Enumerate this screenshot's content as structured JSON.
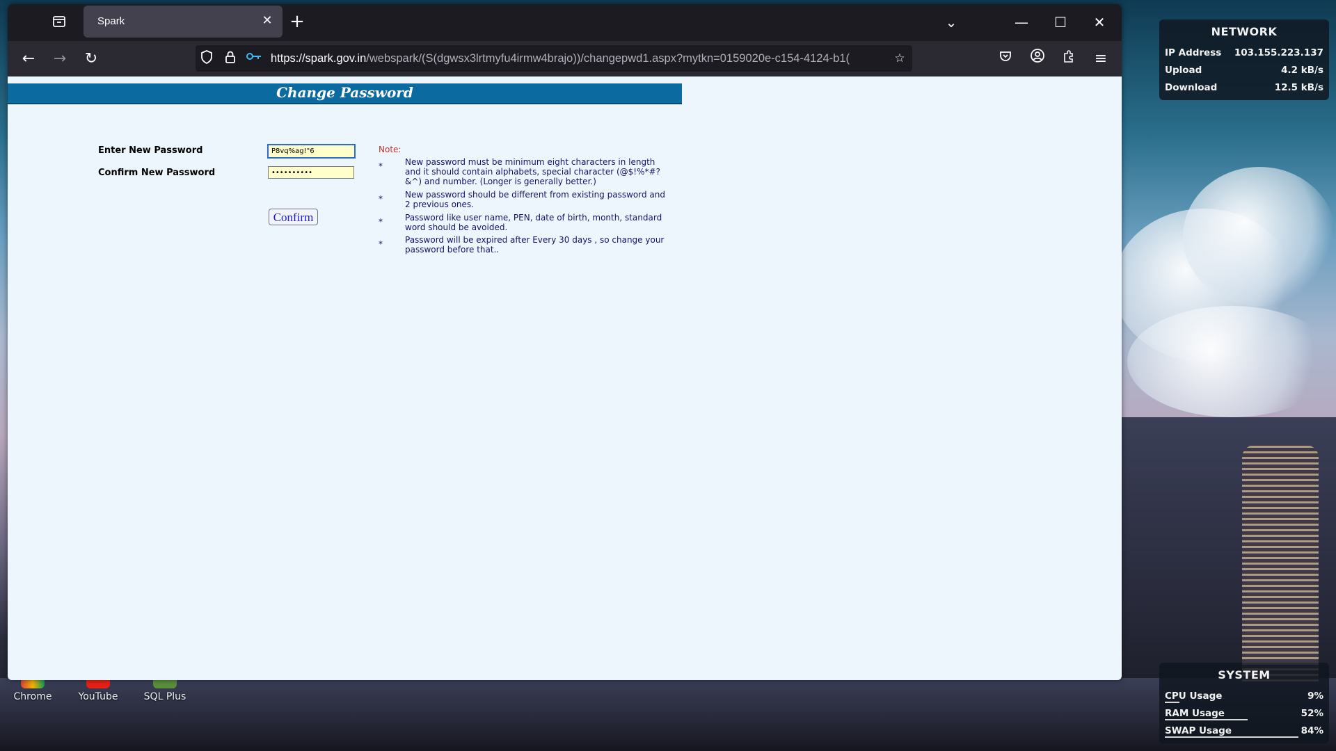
{
  "browser": {
    "tab_title": "Spark",
    "url_host": "https://spark.gov.in",
    "url_path": "/webspark/(S(dgwsx3lrtmyfu4irmw4brajo))/changepwd1.aspx?mytkn=0159020e-c154-4124-b1("
  },
  "page": {
    "title": "Change Password",
    "new_password_label": "Enter New Password",
    "new_password_value": "P8vq%ag!\"6",
    "confirm_password_label": "Confirm New Password",
    "confirm_password_value": "••••••••••",
    "confirm_button": "Confirm",
    "note_label": "Note:",
    "notes": [
      "New password  must be minimum eight characters in length and it should contain alphabets, special character (@$!%*#?&^) and number. (Longer is generally better.)",
      "New password should be different from existing password and 2 previous ones.",
      "Password like user name, PEN, date of birth, month, standard word should be avoided.",
      "Password will be expired after Every 30 days , so change your password before that.."
    ],
    "bullet": "*"
  },
  "desktop": {
    "icons": [
      {
        "label": "Chrome"
      },
      {
        "label": "YouTube"
      },
      {
        "label": "SQL Plus"
      }
    ]
  },
  "network_widget": {
    "title": "NETWORK",
    "rows": [
      {
        "label": "IP Address",
        "value": "103.155.223.137"
      },
      {
        "label": "Upload",
        "value": "4.2 kB/s"
      },
      {
        "label": "Download",
        "value": "12.5 kB/s"
      }
    ]
  },
  "system_widget": {
    "title": "SYSTEM",
    "rows": [
      {
        "label": "CPU Usage",
        "value": "9%",
        "level": 0.09
      },
      {
        "label": "RAM Usage",
        "value": "52%",
        "level": 0.52
      },
      {
        "label": "SWAP Usage",
        "value": "84%",
        "level": 0.84
      }
    ]
  }
}
